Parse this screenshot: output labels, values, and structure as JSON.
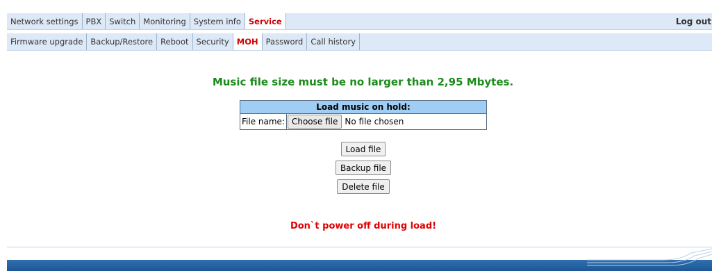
{
  "topnav": {
    "items": [
      {
        "label": "Network settings"
      },
      {
        "label": "PBX"
      },
      {
        "label": "Switch"
      },
      {
        "label": "Monitoring"
      },
      {
        "label": "System info"
      },
      {
        "label": "Service"
      }
    ],
    "active": "Service",
    "logout_label": "Log out"
  },
  "subnav": {
    "items": [
      {
        "label": "Firmware upgrade"
      },
      {
        "label": "Backup/Restore"
      },
      {
        "label": "Reboot"
      },
      {
        "label": "Security"
      },
      {
        "label": "MOH"
      },
      {
        "label": "Password"
      },
      {
        "label": "Call history"
      }
    ],
    "active": "MOH"
  },
  "main": {
    "notice": "Music file size must be no larger than 2,95 Mbytes.",
    "table_title": "Load music on hold:",
    "file_label": "File name:",
    "choose_file_label": "Choose file",
    "no_file_text": "No file chosen",
    "load_button": "Load file",
    "backup_button": "Backup file",
    "delete_button": "Delete file",
    "warning": "Don`t power off during load!"
  },
  "colors": {
    "nav_bg": "#dde9f6",
    "active_tab_text": "#cc0000",
    "notice": "#1d8a1d",
    "warning": "#e00000",
    "table_header": "#9fcdf3",
    "footer_bar": "#2f6fb0"
  }
}
